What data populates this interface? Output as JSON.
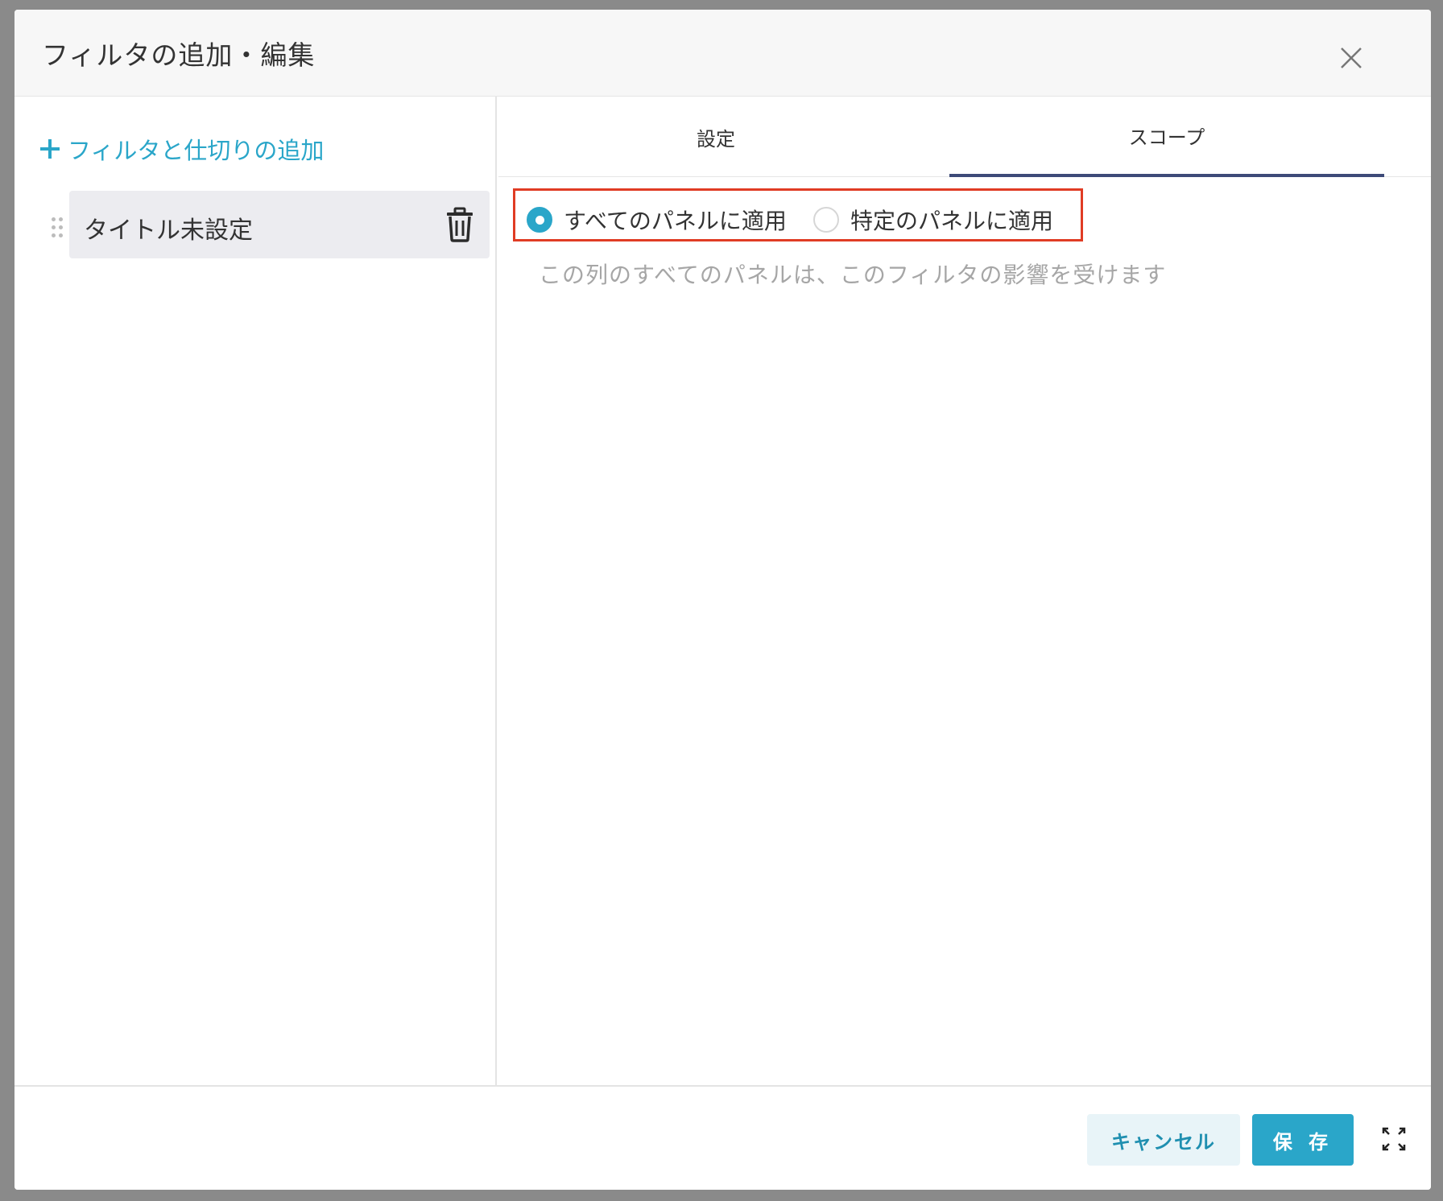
{
  "dialog": {
    "title": "フィルタの追加・編集",
    "close_icon": "close-icon"
  },
  "sidebar": {
    "add_link_label": "フィルタと仕切りの追加",
    "items": [
      {
        "label": "タイトル未設定"
      }
    ]
  },
  "tabs": [
    {
      "label": "設定",
      "active": false
    },
    {
      "label": "スコープ",
      "active": true
    }
  ],
  "scope": {
    "options": [
      {
        "label": "すべてのパネルに適用",
        "selected": true
      },
      {
        "label": "特定のパネルに適用",
        "selected": false
      }
    ],
    "description": "この列のすべてのパネルは、このフィルタの影響を受けます"
  },
  "footer": {
    "cancel_label": "キャンセル",
    "save_label": "保 存"
  },
  "colors": {
    "accent": "#2aa6c9",
    "highlight_border": "#e03c24",
    "active_tab_underline": "#3d4a78"
  }
}
